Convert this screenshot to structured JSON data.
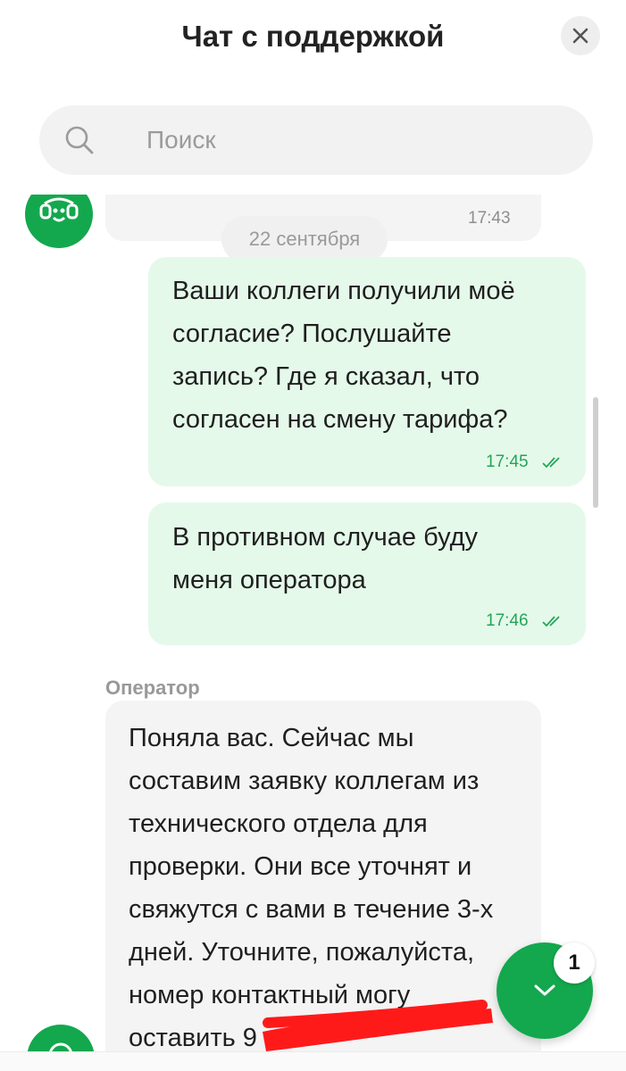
{
  "header": {
    "title": "Чат с поддержкой",
    "close_icon": "close-icon"
  },
  "search": {
    "placeholder": "Поиск",
    "icon": "search-icon"
  },
  "chat": {
    "prev_message": {
      "time": "17:43"
    },
    "date_separator": "22 сентября",
    "messages_out": [
      {
        "lines": [
          "Ваши коллеги получили моё",
          "согласие? Послушайте",
          "запись? Где я сказал, что",
          "согласен на смену тарифа?"
        ],
        "time": "17:45",
        "status": "read"
      },
      {
        "lines": [
          "В противном случае буду",
          "меня оператора"
        ],
        "time": "17:46",
        "status": "read"
      }
    ],
    "operator_message": {
      "sender": "Оператор",
      "lines": [
        "Поняла вас. Сейчас мы",
        "составим заявку коллегам из",
        "технического отдела для",
        "проверки. Они все уточнят и",
        "свяжутся с вами в течение 3-х",
        "дней. Уточните, пожалуйста,",
        "номер контактный могу",
        "оставить 9"
      ]
    }
  },
  "fab": {
    "icon": "chevron-down-icon",
    "badge_count": "1"
  },
  "colors": {
    "brand_green": "#13a84d",
    "outgoing_bubble": "#e5f9ea",
    "incoming_bubble": "#f4f4f4",
    "redaction": "#ff1a1a"
  }
}
